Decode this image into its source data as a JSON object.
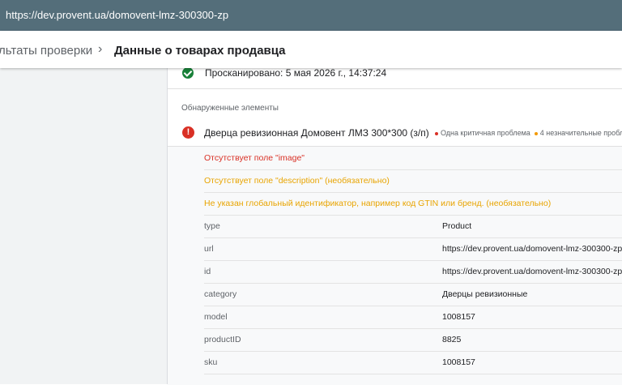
{
  "browser": {
    "url": "https://dev.provent.ua/domovent-lmz-300300-zp"
  },
  "header": {
    "breadcrumb_prev": "льтаты проверки",
    "breadcrumb_sep": "›",
    "breadcrumb_current": "Данные о товарах продавца"
  },
  "scan": {
    "text": "Просканировано: 5 мая 2026 г., 14:37:24"
  },
  "detected": {
    "section_label": "Обнаруженные элементы",
    "item_title": "Дверца ревизионная Домовент ЛМЗ 300*300 (з/п)",
    "critical_summary": "Одна критичная проблема",
    "minor_summary": "4 незначительные пробле"
  },
  "issues": [
    {
      "text": "Отсутствует поле \"image\"",
      "level": "critical"
    },
    {
      "text": "Отсутствует поле \"description\" (необязательно)",
      "level": "warning"
    },
    {
      "text": "Не указан глобальный идентификатор, например код GTIN или бренд. (необязательно)",
      "level": "warning"
    }
  ],
  "properties": [
    {
      "key": "type",
      "value": "Product"
    },
    {
      "key": "url",
      "value": "https://dev.provent.ua/domovent-lmz-300300-zp"
    },
    {
      "key": "id",
      "value": "https://dev.provent.ua/domovent-lmz-300300-zp"
    },
    {
      "key": "category",
      "value": "Дверцы ревизионные"
    },
    {
      "key": "model",
      "value": "1008157"
    },
    {
      "key": "productID",
      "value": "8825"
    },
    {
      "key": "sku",
      "value": "1008157"
    }
  ],
  "colors": {
    "topbar": "#546e7a",
    "success": "#188038",
    "critical": "#d93025",
    "warning": "#e8a400"
  }
}
